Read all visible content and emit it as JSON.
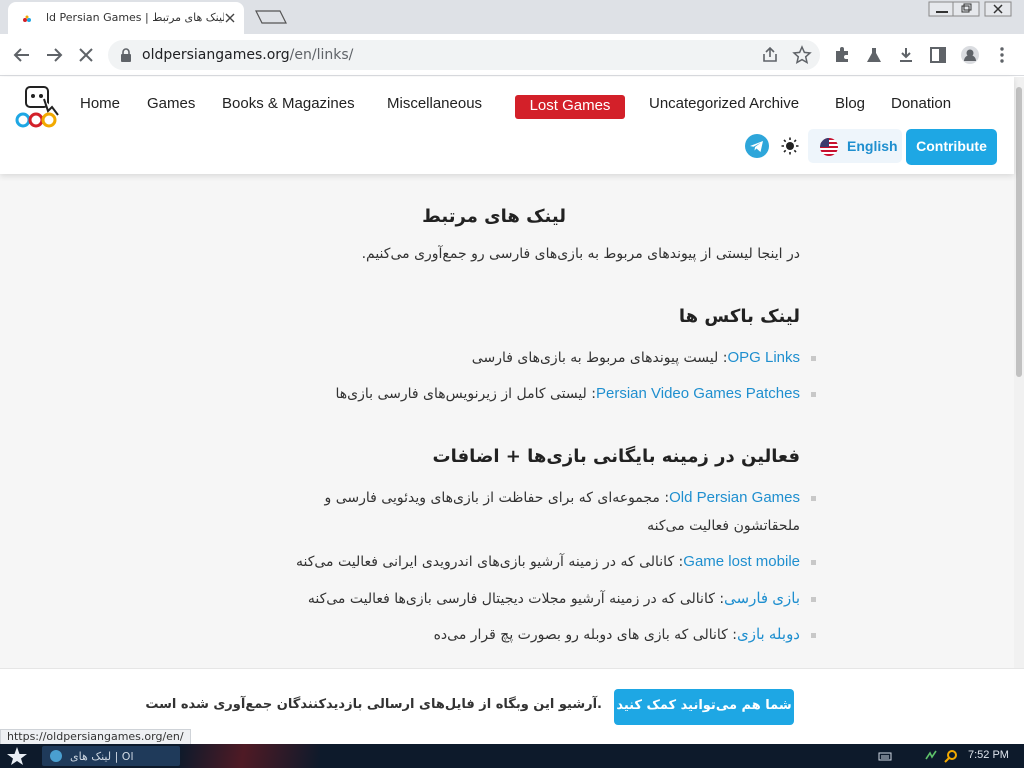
{
  "browser": {
    "tab_title": "ld Persian Games | لینک های مرتبط",
    "url_host": "oldpersiangames.org",
    "url_path": "/en/links/",
    "status_url": "https://oldpersiangames.org/en/"
  },
  "site": {
    "nav": [
      "Home",
      "Games",
      "Books & Magazines",
      "Miscellaneous",
      "Lost Games",
      "Uncategorized Archive",
      "Blog",
      "Donation"
    ],
    "language_label": "English",
    "contribute_label": "Contribute",
    "colors": {
      "accent": "#1ea7e4",
      "lost_games": "#d32029",
      "link": "#1f8fcf"
    }
  },
  "page": {
    "title": "لینک های مرتبط",
    "intro": "در اینجا لیستی از پیوندهای مربوط به بازی‌های فارسی رو جمع‌آوری می‌کنیم.",
    "sections": [
      {
        "heading": "لینک باکس ها",
        "items": [
          {
            "link": "OPG Links",
            "text": ": لیست پیوندهای مربوط به بازی‌های فارسی"
          },
          {
            "link": "Persian Video Games Patches",
            "text": ": لیستی کامل از زیرنویس‌های فارسی بازی‌ها"
          }
        ]
      },
      {
        "heading": "فعالین در زمینه بایگانی بازی‌ها + اضافات",
        "items": [
          {
            "link": "Old Persian Games",
            "text": ": مجموعه‌ای که برای حفاظت از بازی‌های ویدئویی فارسی و ملحقاتشون فعالیت می‌کنه"
          },
          {
            "link": "Game lost mobile",
            "text": ": کانالی که در زمینه آرشیو بازی‌های اندرویدی ایرانی فعالیت می‌کنه"
          },
          {
            "link": "بازی فارسی",
            "text": ": کانالی که در زمینه آرشیو مجلات دیجیتال فارسی بازی‌ها فعالیت می‌کنه"
          },
          {
            "link": "دوبله بازی",
            "text": ": کانالی که بازی های دوبله رو بصورت پچ قرار می‌ده"
          }
        ]
      }
    ]
  },
  "notice": {
    "text": ".آرشیو این وبگاه از فایل‌های ارسالی بازدیدکنندگان جمع‌آوری شده است",
    "button": "شما هم می‌توانید کمک کنید"
  },
  "taskbar": {
    "app_label": "لینک های | Ol",
    "clock": "7:52 PM"
  }
}
